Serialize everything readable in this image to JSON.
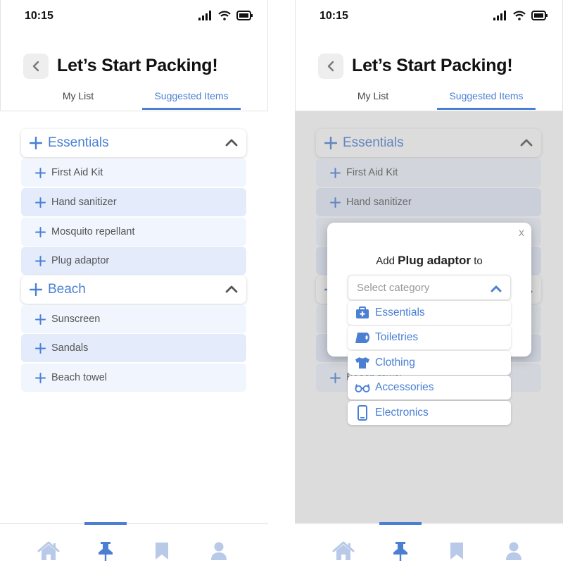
{
  "status": {
    "time": "10:15"
  },
  "header": {
    "title": "Let’s Start Packing!",
    "tabs": [
      "My List",
      "Suggested Items"
    ]
  },
  "categories": [
    {
      "label": "Essentials",
      "items": [
        "First Aid Kit",
        "Hand sanitizer",
        "Mosquito repellant",
        "Plug adaptor"
      ]
    },
    {
      "label": "Beach",
      "items": [
        "Sunscreen",
        "Sandals",
        "Beach towel"
      ]
    }
  ],
  "modal": {
    "prefix": "Add",
    "item": "Plug adaptor",
    "suffix": "to",
    "close": "x",
    "select_placeholder": "Select category",
    "options": [
      {
        "label": "Essentials",
        "icon": "first-aid-icon"
      },
      {
        "label": "Toiletries",
        "icon": "toilet-paper-icon"
      },
      {
        "label": "Clothing",
        "icon": "shirt-icon"
      },
      {
        "label": "Accessories",
        "icon": "glasses-icon"
      },
      {
        "label": "Electronics",
        "icon": "phone-icon"
      }
    ]
  },
  "nav": {
    "active": "pin",
    "items": [
      "home-icon",
      "pin-icon",
      "bookmark-icon",
      "user-icon"
    ]
  },
  "colors": {
    "accent": "#4a7fd4",
    "item_light": "#f0f5fe",
    "item_dark": "#e4ecfc",
    "nav_inactive": "#b9c9e8"
  }
}
